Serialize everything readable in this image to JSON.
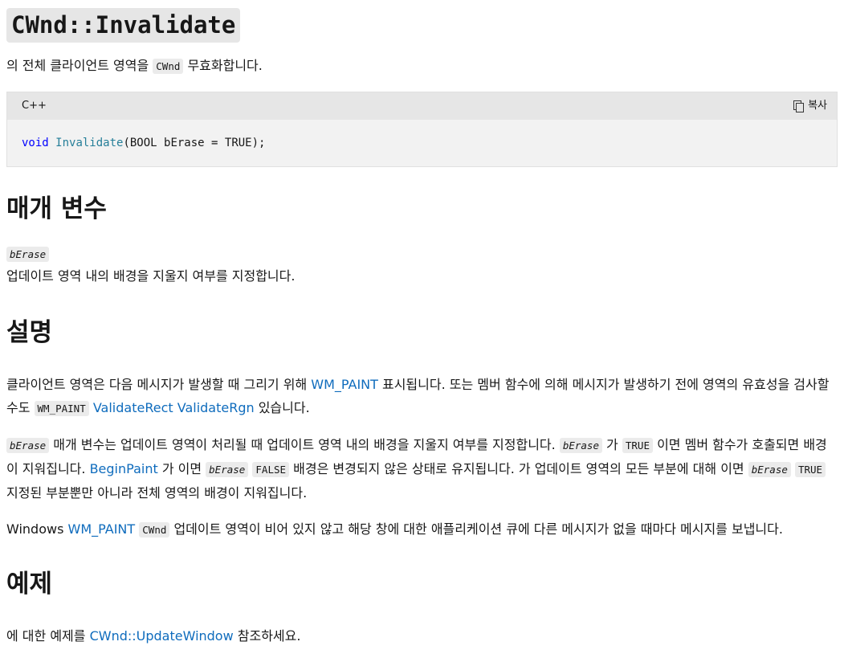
{
  "title": "CWnd::Invalidate",
  "intro": {
    "before": "의 전체 클라이언트 영역을 ",
    "code": "CWnd",
    "after": " 무효화합니다."
  },
  "code_block": {
    "language": "C++",
    "copy_label": "복사",
    "keyword": "void",
    "function": "Invalidate",
    "rest": "(BOOL bErase = TRUE);"
  },
  "parameters": {
    "heading": "매개 변수",
    "name": "bErase",
    "description": "업데이트 영역 내의 배경을 지울지 여부를 지정합니다."
  },
  "remarks": {
    "heading": "설명",
    "p1": {
      "t1": "클라이언트 영역은 다음 메시지가 발생할 때 그리기 위해 ",
      "link1": "WM_PAINT",
      "t2": " 표시됩니다. 또는 멤버 함수에 의해 메시지가 발생하기 전에 영역의 유효성을 검사할 수도 ",
      "code1": "WM_PAINT",
      "link2": "ValidateRect",
      "link3": "ValidateRgn",
      "t3": " 있습니다."
    },
    "p2": {
      "code1": "bErase",
      "t1": " 매개 변수는 업데이트 영역이 처리될 때 업데이트 영역 내의 배경을 지울지 여부를 지정합니다. ",
      "code2": "bErase",
      "t2": " 가 ",
      "code3": "TRUE",
      "t3": " 이면 멤버 함수가 호출되면 배경이 지워집니다. ",
      "link1": "BeginPaint",
      "t4": " 가 이면 ",
      "code4": "bErase",
      "code5": "FALSE",
      "t5": " 배경은 변경되지 않은 상태로 유지됩니다. 가 업데이트 영역의 모든 부분에 대해 이면 ",
      "code6": "bErase",
      "code7": "TRUE",
      "t6": " 지정된 부분뿐만 아니라 전체 영역의 배경이 지워집니다."
    },
    "p3": {
      "t1": "Windows ",
      "link1": "WM_PAINT",
      "code1": "CWnd",
      "t2": " 업데이트 영역이 비어 있지 않고 해당 창에 대한 애플리케이션 큐에 다른 메시지가 없을 때마다 메시지를 보냅니다."
    }
  },
  "example": {
    "heading": "예제",
    "t1": "에 대한 예제를 ",
    "link1": "CWnd::UpdateWindow",
    "t2": " 참조하세요."
  }
}
